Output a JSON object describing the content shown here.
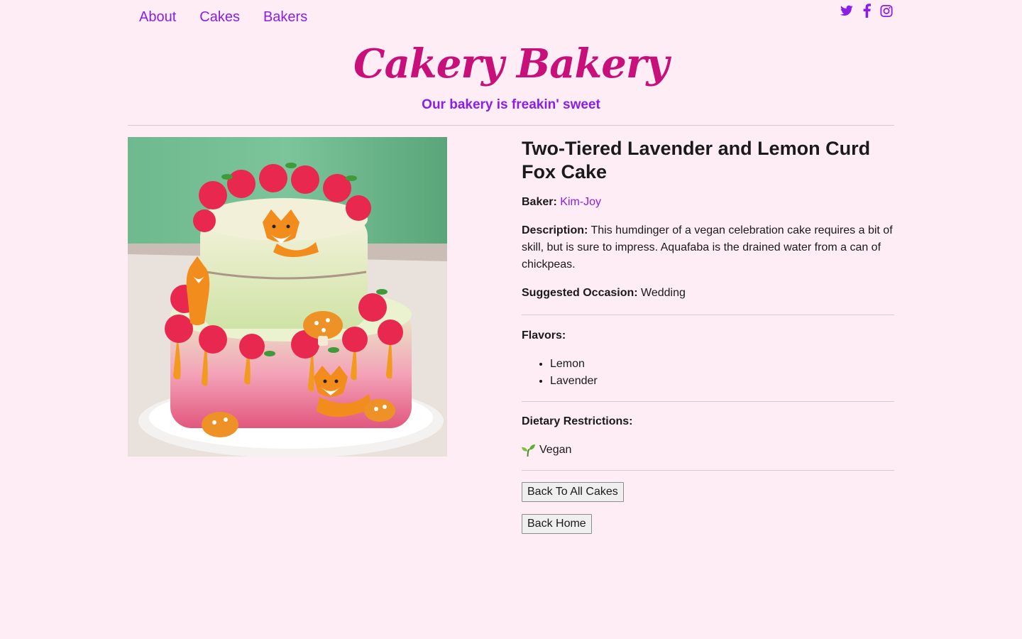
{
  "nav": {
    "items": [
      {
        "label": "About"
      },
      {
        "label": "Cakes"
      },
      {
        "label": "Bakers"
      }
    ]
  },
  "social": {
    "icons": [
      "twitter-icon",
      "facebook-icon",
      "instagram-icon"
    ],
    "color": "#8a1ee6"
  },
  "header": {
    "brand": "Cakery Bakery",
    "tagline": "Our bakery is freakin' sweet"
  },
  "colors": {
    "background": "#ffedf5",
    "accent": "#8a1ee6",
    "brand": "#c8107a"
  },
  "cake": {
    "title": "Two-Tiered Lavender and Lemon Curd Fox Cake",
    "baker_label": "Baker:",
    "baker_name": "Kim-Joy",
    "description_label": "Description:",
    "description": "This humdinger of a vegan celebration cake requires a bit of skill, but is sure to impress. Aquafaba is the drained water from a can of chickpeas.",
    "occasion_label": "Suggested Occasion:",
    "occasion": "Wedding",
    "flavors_label": "Flavors:",
    "flavors": [
      "Lemon",
      "Lavender"
    ],
    "dietary_label": "Dietary Restrictions:",
    "dietary_icon": "seedling-icon",
    "dietary": "Vegan"
  },
  "buttons": {
    "back_to_cakes": "Back To All Cakes",
    "back_home": "Back Home"
  }
}
